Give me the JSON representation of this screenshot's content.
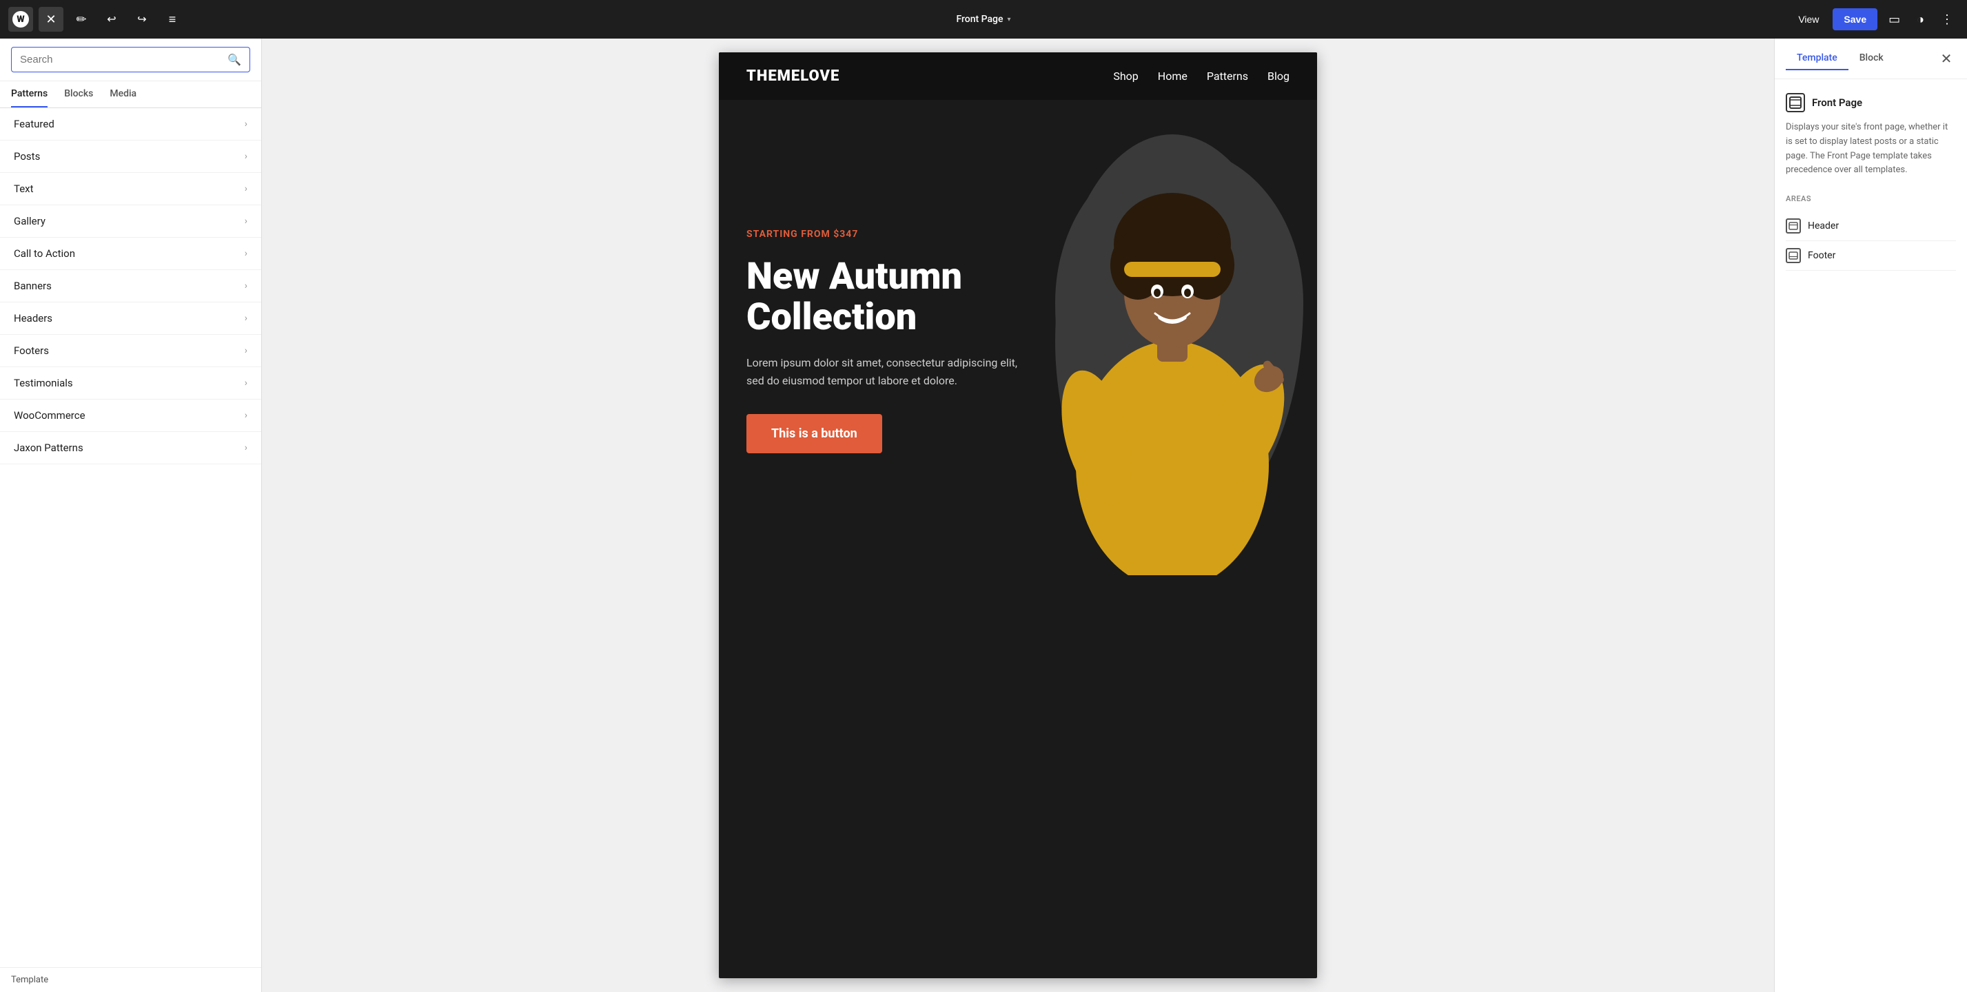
{
  "topbar": {
    "wp_logo_text": "W",
    "close_label": "✕",
    "pen_icon": "✏",
    "undo_icon": "↩",
    "redo_icon": "↪",
    "list_icon": "≡",
    "page_title": "Front Page",
    "chevron": "▾",
    "view_label": "View",
    "save_label": "Save",
    "sidebar_icon": "⬜",
    "contrast_icon": "◑",
    "more_icon": "⋮"
  },
  "left_panel": {
    "search_placeholder": "Search",
    "tabs": [
      {
        "label": "Patterns",
        "active": true
      },
      {
        "label": "Blocks",
        "active": false
      },
      {
        "label": "Media",
        "active": false
      }
    ],
    "patterns": [
      {
        "label": "Featured"
      },
      {
        "label": "Posts"
      },
      {
        "label": "Text"
      },
      {
        "label": "Gallery"
      },
      {
        "label": "Call to Action"
      },
      {
        "label": "Banners"
      },
      {
        "label": "Headers"
      },
      {
        "label": "Footers"
      },
      {
        "label": "Testimonials"
      },
      {
        "label": "WooCommerce"
      },
      {
        "label": "Jaxon Patterns"
      }
    ],
    "footer_label": "Template"
  },
  "canvas": {
    "site_logo": "THEMELOVE",
    "nav_items": [
      "Shop",
      "Home",
      "Patterns",
      "Blog"
    ],
    "hero_label": "STARTING FROM $347",
    "hero_title": "New Autumn Collection",
    "hero_desc": "Lorem ipsum dolor sit amet, consectetur adipiscing elit, sed do eiusmod tempor ut labore et dolore.",
    "hero_button": "This is a button"
  },
  "right_panel": {
    "tabs": [
      {
        "label": "Template",
        "active": true
      },
      {
        "label": "Block",
        "active": false
      }
    ],
    "close_icon": "✕",
    "template_icon": "⊞",
    "template_name": "Front Page",
    "template_desc": "Displays your site's front page, whether it is set to display latest posts or a static page. The Front Page template takes precedence over all templates.",
    "areas_label": "AREAS",
    "areas": [
      {
        "label": "Header",
        "icon": "⊟"
      },
      {
        "label": "Footer",
        "icon": "⊟"
      }
    ]
  }
}
